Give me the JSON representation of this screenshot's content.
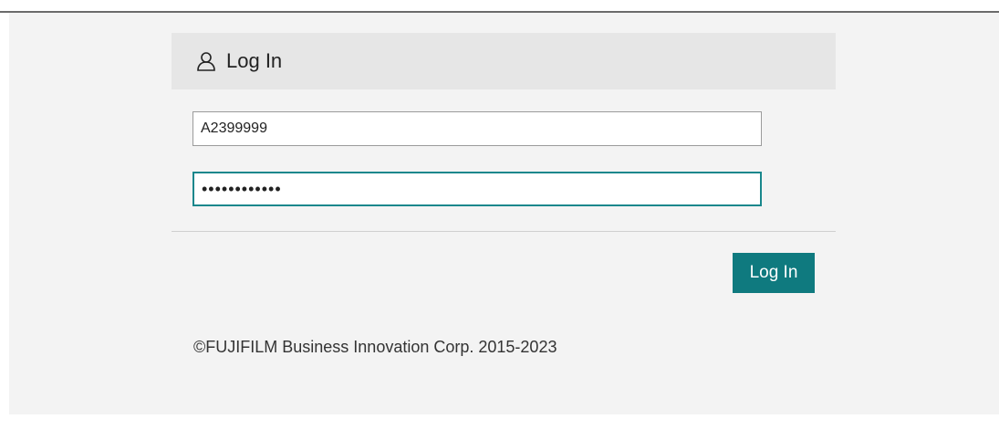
{
  "header": {
    "icon": "user-icon",
    "title": "Log In"
  },
  "form": {
    "username_value": "A2399999",
    "password_value": "••••••••••••"
  },
  "actions": {
    "login_label": "Log In"
  },
  "footer": {
    "copyright": "©FUJIFILM Business Innovation Corp. 2015-2023"
  },
  "colors": {
    "accent": "#0f7a7f",
    "focus_border": "#19878c",
    "panel_bg": "#f3f3f3",
    "header_bg": "#e6e6e6"
  }
}
